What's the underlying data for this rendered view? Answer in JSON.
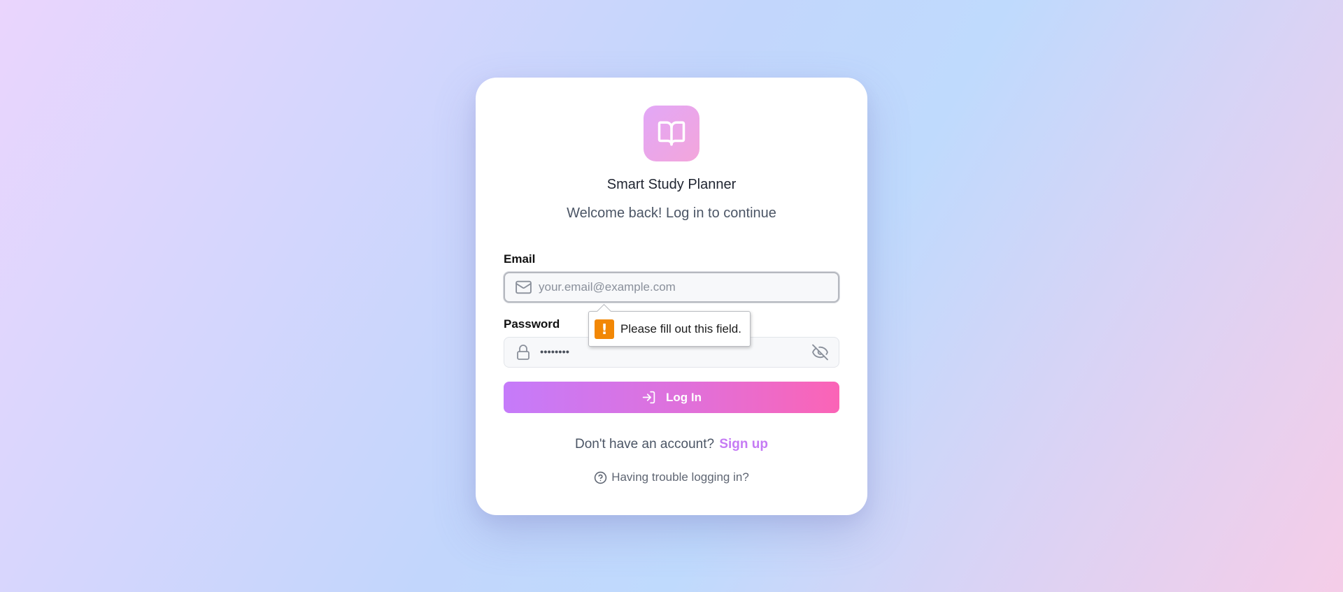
{
  "app": {
    "title": "Smart Study Planner",
    "subtitle": "Welcome back! Log in to continue",
    "logo_icon": "open-book-icon"
  },
  "form": {
    "email": {
      "label": "Email",
      "placeholder": "your.email@example.com",
      "value": "",
      "icon": "mail-icon"
    },
    "password": {
      "label": "Password",
      "masked_value": "••••••••",
      "icon": "lock-icon",
      "toggle_icon": "eye-off-icon"
    },
    "submit": {
      "label": "Log In",
      "icon": "log-in-icon"
    }
  },
  "validation_tooltip": {
    "message": "Please fill out this field.",
    "icon": "!",
    "icon_color": "#f28705"
  },
  "footer": {
    "signup_prompt": "Don't have an account?",
    "signup_link": "Sign up",
    "help_text": "Having trouble logging in?",
    "help_icon": "help-circle-icon"
  },
  "colors": {
    "gradient_start": "#c57bfa",
    "gradient_end": "#fb64b6",
    "link": "#c57bf4"
  }
}
